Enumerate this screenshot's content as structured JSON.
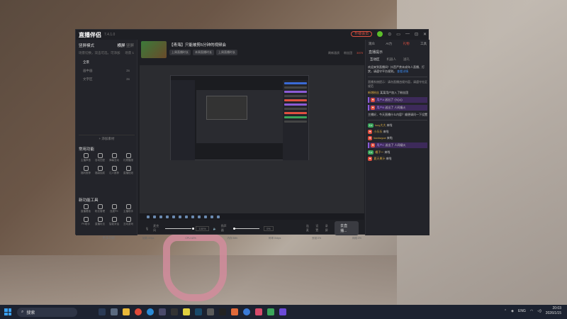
{
  "app": {
    "logo": "直播伴侣",
    "version": "7.4.1.0",
    "upgrade": "升级会员",
    "window_controls": [
      "⊙",
      "▭",
      "—",
      "⊡",
      "✕"
    ]
  },
  "left_panel": {
    "mode_label": "竖屏模式",
    "mode_tabs": [
      "横屏",
      "竖屏"
    ],
    "sub_left": "场景切换，双击可选，可添加",
    "sub_right": "场景 1",
    "scenes": [
      {
        "name": "全景",
        "val": ""
      },
      {
        "name": "画中画",
        "val": "2x"
      },
      {
        "name": "文字区",
        "val": "2x"
      }
    ],
    "add_source": "+ 添加素材",
    "sec1": "常用功能",
    "sec1_items": [
      "主播声音",
      "自动匹配",
      "弹幕互动",
      "礼物播报",
      "福利推荐",
      "福袋抽奖",
      "达人推荐",
      "直播贴纸"
    ],
    "sec2": "新功能工具",
    "sec2_items": [
      "直播看板",
      "粉丝管理",
      "连麦PK",
      "主播助手",
      "PK助手",
      "直播玩法",
      "智能对话",
      "互动游戏"
    ],
    "more": "··· 更多功能"
  },
  "center": {
    "title": "【青海】只能被剪5分钟的视频会",
    "tags": [
      "上周直播时长",
      "本周直播时长",
      "上周直播时长"
    ],
    "stats": [
      "刷新画质",
      "粉丝团",
      "3979"
    ],
    "controls": {
      "mic_label": "麦克风",
      "mic_pct": "100%",
      "speaker_label": "扬声器",
      "speaker_pct": "0%",
      "buttons": [
        "连麦",
        "设置",
        "录屏"
      ],
      "live_button": "去直播..."
    },
    "status": [
      "帧数:30fps",
      "CPU:42%",
      "内存:5Mb",
      "码率:0kbps",
      "丢帧:0%",
      "网络:0%"
    ]
  },
  "right_panel": {
    "tabs": [
      "观众",
      "AI力",
      "礼物",
      "工具"
    ],
    "title": "直播提示",
    "sub_tabs": [
      "互动区",
      "机器人",
      "送礼"
    ],
    "messages": [
      {
        "kind": "plain",
        "text": "欢迎来到直播间！抖音严禁未成年人直播、打赏，请遵守平台规则。",
        "link": "查看详情"
      },
      {
        "kind": "sys",
        "text": "直播系统提示：请勿直播违规内容，请遵守社区规范"
      },
      {
        "kind": "purple",
        "user": "新增粉丝",
        "text": "某某用户加入了粉丝团"
      },
      {
        "kind": "purple",
        "user": "用户A",
        "text": "送出了 小心心"
      },
      {
        "kind": "purple",
        "user": "用户B",
        "text": "送出了 人间烟火"
      },
      {
        "kind": "plain",
        "text": "主播好，今天直播什么内容？顺便请问一下设置"
      },
      {
        "kind": "chat",
        "user": "lucy大大",
        "text": "来啦"
      },
      {
        "kind": "chat",
        "user": "小乐乐",
        "text": "来啦"
      },
      {
        "kind": "chat",
        "user": "tianhuyue",
        "text": "来啦"
      },
      {
        "kind": "purple",
        "user": "用户C",
        "text": "送出了 人间烟火"
      },
      {
        "kind": "chat",
        "user": "橘子～",
        "text": "来啦"
      },
      {
        "kind": "chat",
        "user": "夏天果汁",
        "text": "来啦"
      }
    ]
  },
  "taskbar": {
    "search_placeholder": "搜索",
    "icons": [
      "start",
      "search",
      "widgets",
      "explorer",
      "chrome",
      "edge",
      "store",
      "terminal",
      "steam",
      "music",
      "wechat",
      "browser",
      "chat",
      "douyin",
      "obs",
      "game"
    ],
    "tray_lang": "ENG",
    "time": "20:03",
    "date": "2026/1/15"
  }
}
